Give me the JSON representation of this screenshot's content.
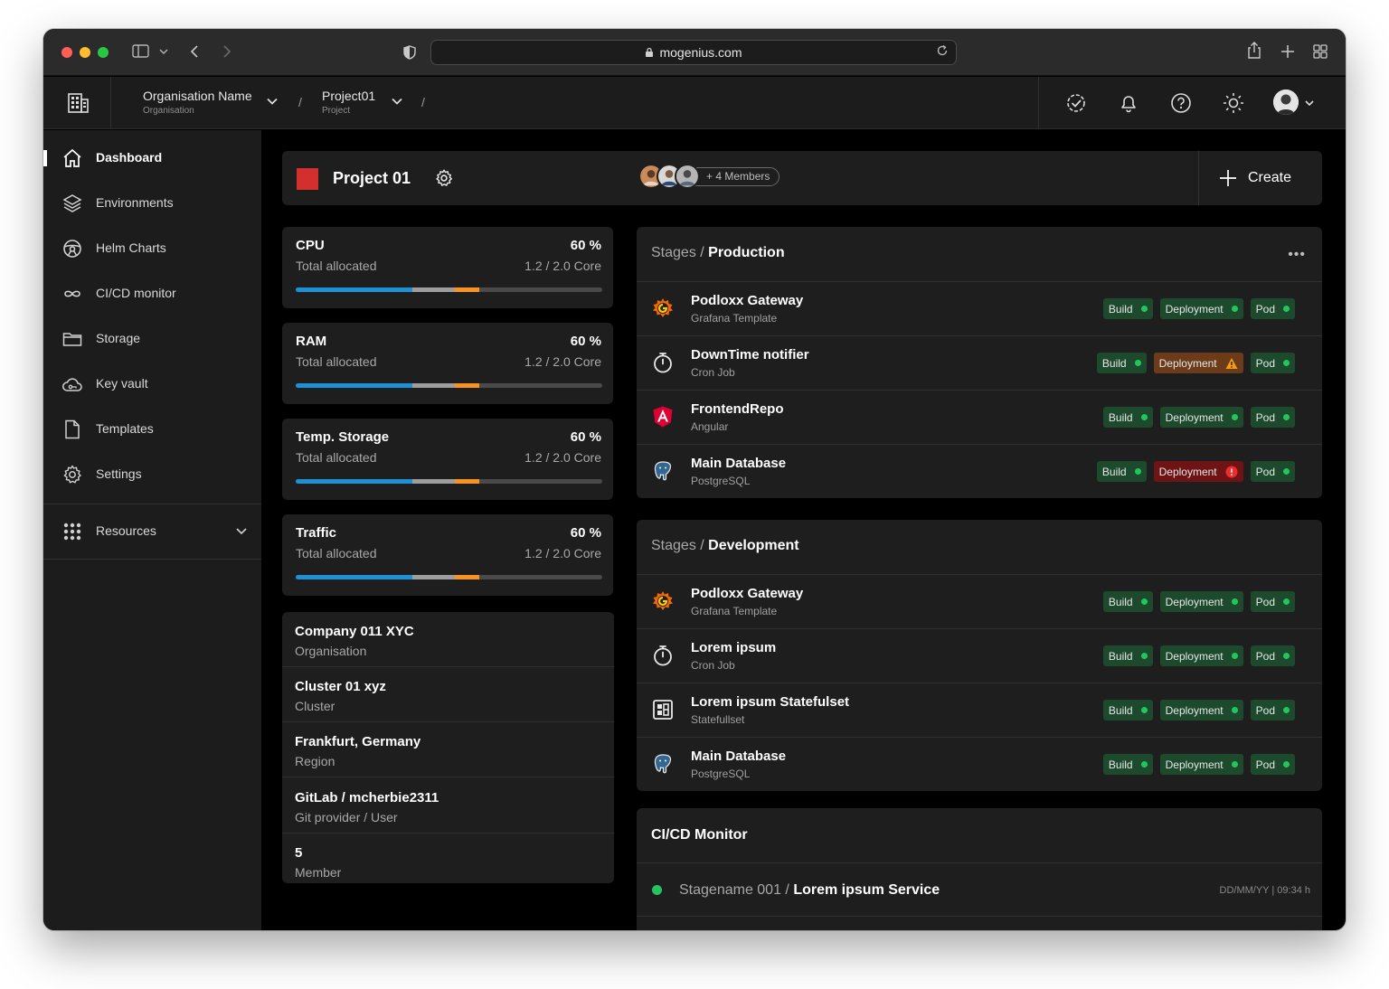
{
  "browser": {
    "url": "mogenius.com"
  },
  "header": {
    "org": {
      "name": "Organisation Name",
      "type": "Organisation"
    },
    "project": {
      "name": "Project01",
      "type": "Project"
    },
    "separator": "/"
  },
  "sidebar": {
    "items": [
      {
        "label": "Dashboard",
        "icon": "home-icon"
      },
      {
        "label": "Environments",
        "icon": "layers-icon"
      },
      {
        "label": "Helm Charts",
        "icon": "helm-icon"
      },
      {
        "label": "CI/CD monitor",
        "icon": "infinity-icon"
      },
      {
        "label": "Storage",
        "icon": "folder-icon"
      },
      {
        "label": "Key vault",
        "icon": "cloud-key-icon"
      },
      {
        "label": "Templates",
        "icon": "document-icon"
      },
      {
        "label": "Settings",
        "icon": "gear-icon"
      }
    ],
    "resources": "Resources"
  },
  "project": {
    "title": "Project 01",
    "color": "#d32f2f",
    "members_label": "+ 4 Members",
    "create_label": "Create"
  },
  "metrics": [
    {
      "name": "CPU",
      "percent": "60 %",
      "sub": "Total allocated",
      "value": "1.2 / 2.0 Core",
      "segments": [
        0.38,
        0.14,
        0.08
      ]
    },
    {
      "name": "RAM",
      "percent": "60 %",
      "sub": "Total allocated",
      "value": "1.2 / 2.0 Core",
      "segments": [
        0.38,
        0.14,
        0.08
      ]
    },
    {
      "name": "Temp. Storage",
      "percent": "60 %",
      "sub": "Total allocated",
      "value": "1.2 / 2.0 Core",
      "segments": [
        0.38,
        0.14,
        0.08
      ]
    },
    {
      "name": "Traffic",
      "percent": "60 %",
      "sub": "Total allocated",
      "value": "1.2 / 2.0 Core",
      "segments": [
        0.38,
        0.14,
        0.08
      ]
    }
  ],
  "bar_colors": {
    "primary": "#1e90d6",
    "secondary": "#9e9e9e",
    "tertiary": "#f7931e",
    "track": "#4a4a4a"
  },
  "info": [
    {
      "title": "Company 011 XYC",
      "sub": "Organisation"
    },
    {
      "title": "Cluster 01 xyz",
      "sub": "Cluster"
    },
    {
      "title": "Frankfurt, Germany",
      "sub": "Region"
    },
    {
      "title": "GitLab / mcherbie2311",
      "sub": "Git provider / User"
    },
    {
      "title": "5",
      "sub": "Member"
    }
  ],
  "stages": {
    "prefix": "Stages /",
    "production": {
      "name": "Production",
      "more": "•••",
      "rows": [
        {
          "name": "Podloxx Gateway",
          "sub": "Grafana Template",
          "icon": "grafana-icon",
          "build": "Build",
          "deployment": "Deployment",
          "pod": "Pod",
          "deployment_status": "ok"
        },
        {
          "name": "DownTime notifier",
          "sub": "Cron Job",
          "icon": "stopwatch-icon",
          "build": "Build",
          "deployment": "Deployment",
          "pod": "Pod",
          "deployment_status": "warning"
        },
        {
          "name": "FrontendRepo",
          "sub": "Angular",
          "icon": "angular-icon",
          "build": "Build",
          "deployment": "Deployment",
          "pod": "Pod",
          "deployment_status": "ok"
        },
        {
          "name": "Main Database",
          "sub": "PostgreSQL",
          "icon": "postgresql-icon",
          "build": "Build",
          "deployment": "Deployment",
          "pod": "Pod",
          "deployment_status": "error"
        }
      ]
    },
    "development": {
      "name": "Development",
      "rows": [
        {
          "name": "Podloxx Gateway",
          "sub": "Grafana Template",
          "icon": "grafana-icon",
          "build": "Build",
          "deployment": "Deployment",
          "pod": "Pod",
          "deployment_status": "ok"
        },
        {
          "name": "Lorem ipsum",
          "sub": "Cron Job",
          "icon": "stopwatch-icon",
          "build": "Build",
          "deployment": "Deployment",
          "pod": "Pod",
          "deployment_status": "ok"
        },
        {
          "name": "Lorem ipsum Statefulset",
          "sub": "Statefullset",
          "icon": "statefulset-icon",
          "build": "Build",
          "deployment": "Deployment",
          "pod": "Pod",
          "deployment_status": "ok"
        },
        {
          "name": "Main Database",
          "sub": "PostgreSQL",
          "icon": "postgresql-icon",
          "build": "Build",
          "deployment": "Deployment",
          "pod": "Pod",
          "deployment_status": "ok"
        }
      ]
    }
  },
  "status_colors": {
    "ok": "#22c55e",
    "warning": "#f59e0b",
    "error": "#ef2b2b"
  },
  "cicd": {
    "title": "CI/CD Monitor",
    "row": {
      "stage": "Stagename 001 /",
      "service": "Lorem ipsum Service",
      "meta": "DD/MM/YY  |  09:34 h"
    }
  }
}
